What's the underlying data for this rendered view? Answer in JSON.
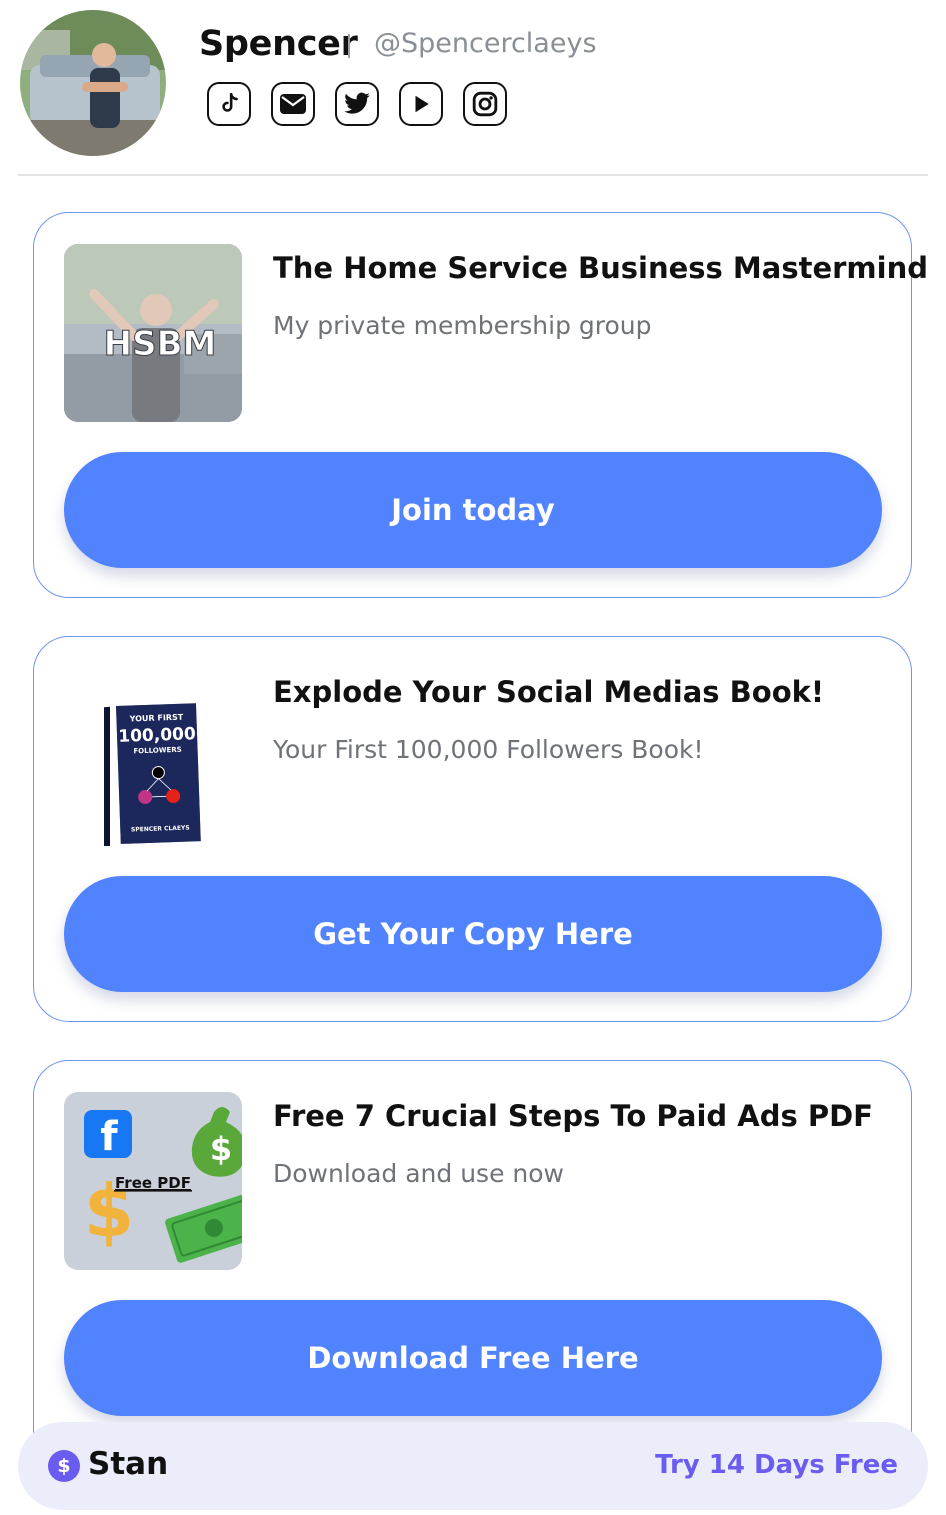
{
  "profile": {
    "name": "Spencer",
    "handle": "@Spencerclaeys",
    "socials": [
      "tiktok-icon",
      "email-icon",
      "twitter-icon",
      "youtube-icon",
      "instagram-icon"
    ]
  },
  "products": [
    {
      "title": "The Home Service Business Mastermind",
      "subtitle": "My private membership group",
      "button": "Join today",
      "thumb_text": "HSBM"
    },
    {
      "title": "Explode Your Social Medias Book!",
      "subtitle": "Your First 100,000 Followers Book!",
      "button": "Get Your Copy Here",
      "cover": {
        "line1": "YOUR FIRST",
        "line2": "100,000",
        "line3": "FOLLOWERS",
        "author": "SPENCER CLAEYS"
      }
    },
    {
      "title": "Free 7 Crucial Steps To Paid Ads PDF",
      "subtitle": "Download and use now",
      "button": "Download Free Here",
      "thumb_text": "Free PDF"
    }
  ],
  "footer": {
    "brand": "Stan",
    "brand_icon": "$",
    "cta": "Try 14 Days Free"
  },
  "colors": {
    "accent": "#5283ff",
    "card_border": "#6f95ec",
    "stan_purple": "#6b5cf0",
    "footer_bg": "#ecedfb"
  }
}
